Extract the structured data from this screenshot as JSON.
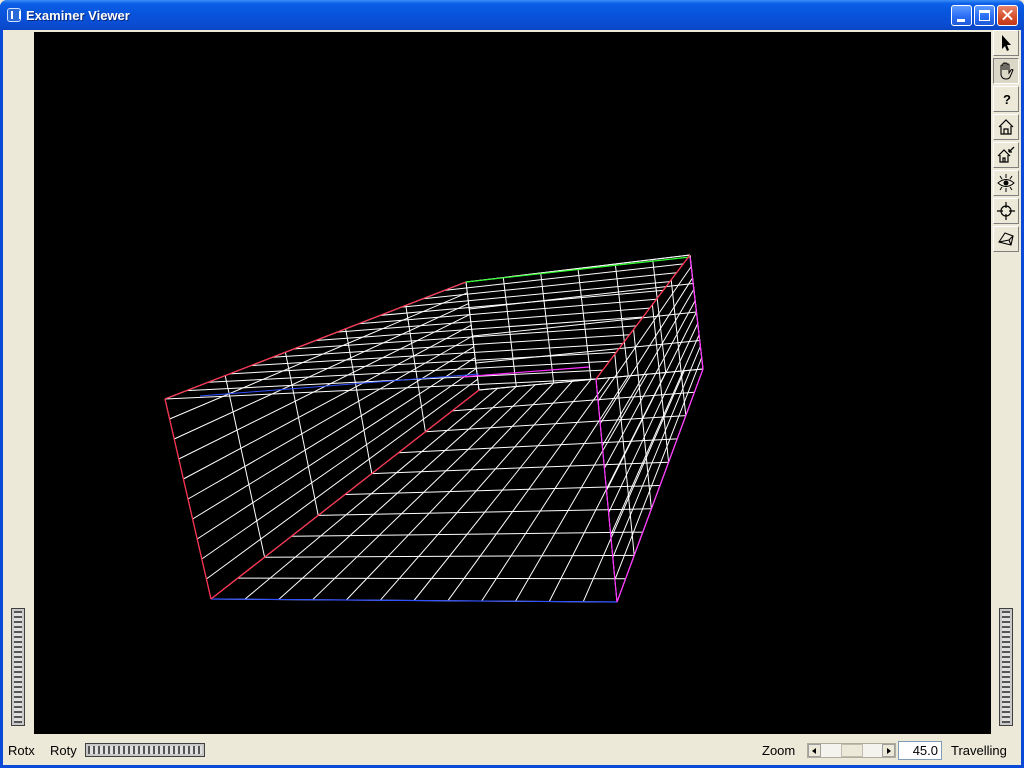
{
  "window": {
    "title": "Examiner Viewer",
    "buttons": {
      "minimize": "minimize-icon",
      "maximize": "maximize-icon",
      "close": "close-icon"
    }
  },
  "toolbar": {
    "tools": [
      {
        "name": "select-arrow-icon",
        "pressed": false
      },
      {
        "name": "hand-view-icon",
        "pressed": true
      },
      {
        "name": "help-question-icon",
        "pressed": false
      },
      {
        "name": "home-icon",
        "pressed": false
      },
      {
        "name": "set-home-icon",
        "pressed": false
      },
      {
        "name": "view-all-eye-icon",
        "pressed": false
      },
      {
        "name": "seek-crosshair-icon",
        "pressed": false
      },
      {
        "name": "perspective-cube-icon",
        "pressed": false
      }
    ]
  },
  "bottom": {
    "rotx_label": "Rotx",
    "roty_label": "Roty",
    "zoom_label": "Zoom",
    "zoom_value": "45.0",
    "dolly_label": "Travelling"
  },
  "colors": {
    "viewport_bg": "#000000",
    "wire_main": "#ffffff",
    "wire_edge_red": "#ff2a4a",
    "wire_edge_magenta": "#ff30ff",
    "wire_edge_green": "#30ff30",
    "wire_edge_blue": "#3050ff"
  }
}
